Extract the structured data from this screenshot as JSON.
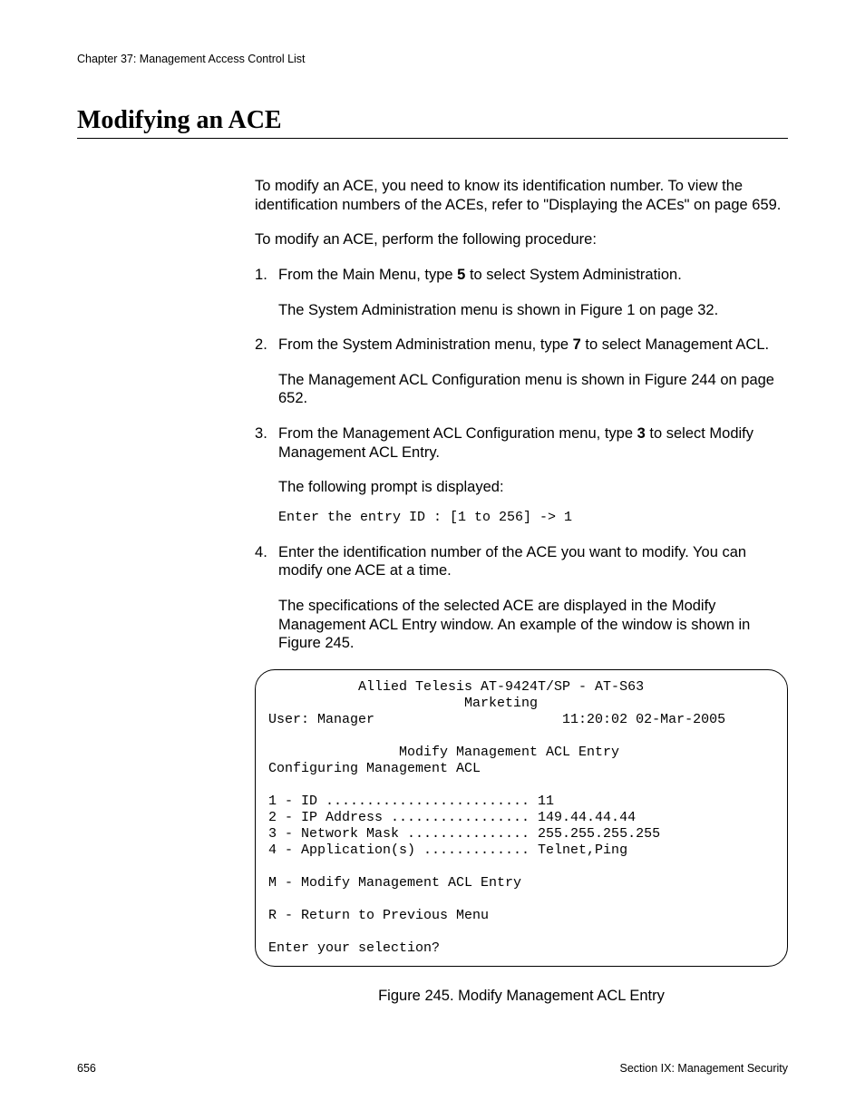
{
  "header": "Chapter 37: Management Access Control List",
  "section_title": "Modifying an ACE",
  "intro": "To modify an ACE, you need to know its identification number. To view the identification numbers of the ACEs, refer to \"Displaying the ACEs\" on page 659.",
  "procedure_intro": "To modify an ACE, perform the following procedure:",
  "steps": [
    {
      "text_before_bold": "From the Main Menu, type ",
      "bold": "5",
      "text_after_bold": " to select System Administration.",
      "sub": "The System Administration menu is shown in Figure 1 on page 32."
    },
    {
      "text_before_bold": "From the System Administration menu, type ",
      "bold": "7",
      "text_after_bold": " to select Management ACL.",
      "sub": "The Management ACL Configuration menu is shown in Figure 244 on page 652."
    },
    {
      "text_before_bold": "From the Management ACL Configuration menu, type ",
      "bold": "3",
      "text_after_bold": " to select Modify Management ACL Entry.",
      "sub": "The following prompt is displayed:",
      "mono": "Enter the entry ID :  [1 to 256] -> 1"
    },
    {
      "text_before_bold": "Enter the identification number of the ACE you want to modify. You can modify one ACE at a time.",
      "bold": "",
      "text_after_bold": "",
      "sub": "The specifications of the selected ACE are displayed in the Modify Management ACL Entry window. An example of the window is shown in Figure 245."
    }
  ],
  "terminal": "           Allied Telesis AT-9424T/SP - AT-S63\n                        Marketing\nUser: Manager                       11:20:02 02-Mar-2005\n\n                Modify Management ACL Entry\nConfiguring Management ACL\n\n1 - ID ......................... 11\n2 - IP Address ................. 149.44.44.44\n3 - Network Mask ............... 255.255.255.255\n4 - Application(s) ............. Telnet,Ping\n\nM - Modify Management ACL Entry\n\nR - Return to Previous Menu\n\nEnter your selection?",
  "figure_caption": "Figure 245. Modify Management ACL Entry",
  "footer_left": "656",
  "footer_right": "Section IX: Management Security"
}
